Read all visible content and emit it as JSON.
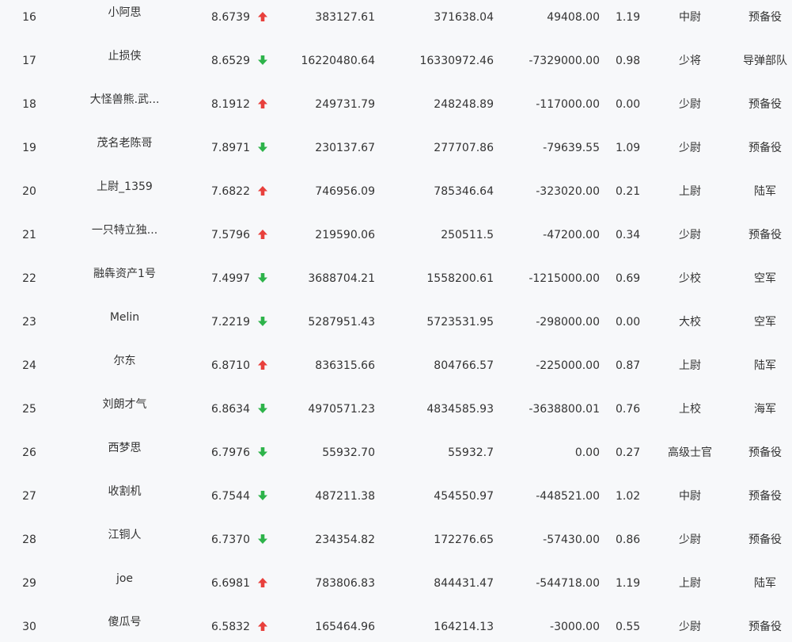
{
  "colors": {
    "up": "#e8403c",
    "down": "#2db34a",
    "text": "#333333",
    "background": "#f7f8fa"
  },
  "rows": [
    {
      "rank": "16",
      "name": "小阿思",
      "score": "8.6739",
      "trend": "up",
      "value1": "383127.61",
      "value2": "371638.04",
      "value3": "49408.00",
      "ratio": "1.19",
      "military_rank": "中尉",
      "branch": "预备役"
    },
    {
      "rank": "17",
      "name": "止损侠",
      "score": "8.6529",
      "trend": "down",
      "value1": "16220480.64",
      "value2": "16330972.46",
      "value3": "-7329000.00",
      "ratio": "0.98",
      "military_rank": "少将",
      "branch": "导弹部队"
    },
    {
      "rank": "18",
      "name": "大怪兽熊.武...",
      "score": "8.1912",
      "trend": "up",
      "value1": "249731.79",
      "value2": "248248.89",
      "value3": "-117000.00",
      "ratio": "0.00",
      "military_rank": "少尉",
      "branch": "预备役"
    },
    {
      "rank": "19",
      "name": "茂名老陈哥",
      "score": "7.8971",
      "trend": "down",
      "value1": "230137.67",
      "value2": "277707.86",
      "value3": "-79639.55",
      "ratio": "1.09",
      "military_rank": "少尉",
      "branch": "预备役"
    },
    {
      "rank": "20",
      "name": "上尉_1359",
      "score": "7.6822",
      "trend": "up",
      "value1": "746956.09",
      "value2": "785346.64",
      "value3": "-323020.00",
      "ratio": "0.21",
      "military_rank": "上尉",
      "branch": "陆军"
    },
    {
      "rank": "21",
      "name": "一只特立独...",
      "score": "7.5796",
      "trend": "up",
      "value1": "219590.06",
      "value2": "250511.5",
      "value3": "-47200.00",
      "ratio": "0.34",
      "military_rank": "少尉",
      "branch": "预备役"
    },
    {
      "rank": "22",
      "name": "融犇资产1号",
      "score": "7.4997",
      "trend": "down",
      "value1": "3688704.21",
      "value2": "1558200.61",
      "value3": "-1215000.00",
      "ratio": "0.69",
      "military_rank": "少校",
      "branch": "空军"
    },
    {
      "rank": "23",
      "name": "Melin",
      "score": "7.2219",
      "trend": "down",
      "value1": "5287951.43",
      "value2": "5723531.95",
      "value3": "-298000.00",
      "ratio": "0.00",
      "military_rank": "大校",
      "branch": "空军"
    },
    {
      "rank": "24",
      "name": "尔东",
      "score": "6.8710",
      "trend": "up",
      "value1": "836315.66",
      "value2": "804766.57",
      "value3": "-225000.00",
      "ratio": "0.87",
      "military_rank": "上尉",
      "branch": "陆军"
    },
    {
      "rank": "25",
      "name": "刘朗才气",
      "score": "6.8634",
      "trend": "down",
      "value1": "4970571.23",
      "value2": "4834585.93",
      "value3": "-3638800.01",
      "ratio": "0.76",
      "military_rank": "上校",
      "branch": "海军"
    },
    {
      "rank": "26",
      "name": "西梦思",
      "score": "6.7976",
      "trend": "down",
      "value1": "55932.70",
      "value2": "55932.7",
      "value3": "0.00",
      "ratio": "0.27",
      "military_rank": "高级士官",
      "branch": "预备役"
    },
    {
      "rank": "27",
      "name": "收割机",
      "score": "6.7544",
      "trend": "down",
      "value1": "487211.38",
      "value2": "454550.97",
      "value3": "-448521.00",
      "ratio": "1.02",
      "military_rank": "中尉",
      "branch": "预备役"
    },
    {
      "rank": "28",
      "name": "江铜人",
      "score": "6.7370",
      "trend": "down",
      "value1": "234354.82",
      "value2": "172276.65",
      "value3": "-57430.00",
      "ratio": "0.86",
      "military_rank": "少尉",
      "branch": "预备役"
    },
    {
      "rank": "29",
      "name": "joe",
      "score": "6.6981",
      "trend": "up",
      "value1": "783806.83",
      "value2": "844431.47",
      "value3": "-544718.00",
      "ratio": "1.19",
      "military_rank": "上尉",
      "branch": "陆军"
    },
    {
      "rank": "30",
      "name": "傻瓜号",
      "score": "6.5832",
      "trend": "up",
      "value1": "165464.96",
      "value2": "164214.13",
      "value3": "-3000.00",
      "ratio": "0.55",
      "military_rank": "少尉",
      "branch": "预备役"
    }
  ]
}
